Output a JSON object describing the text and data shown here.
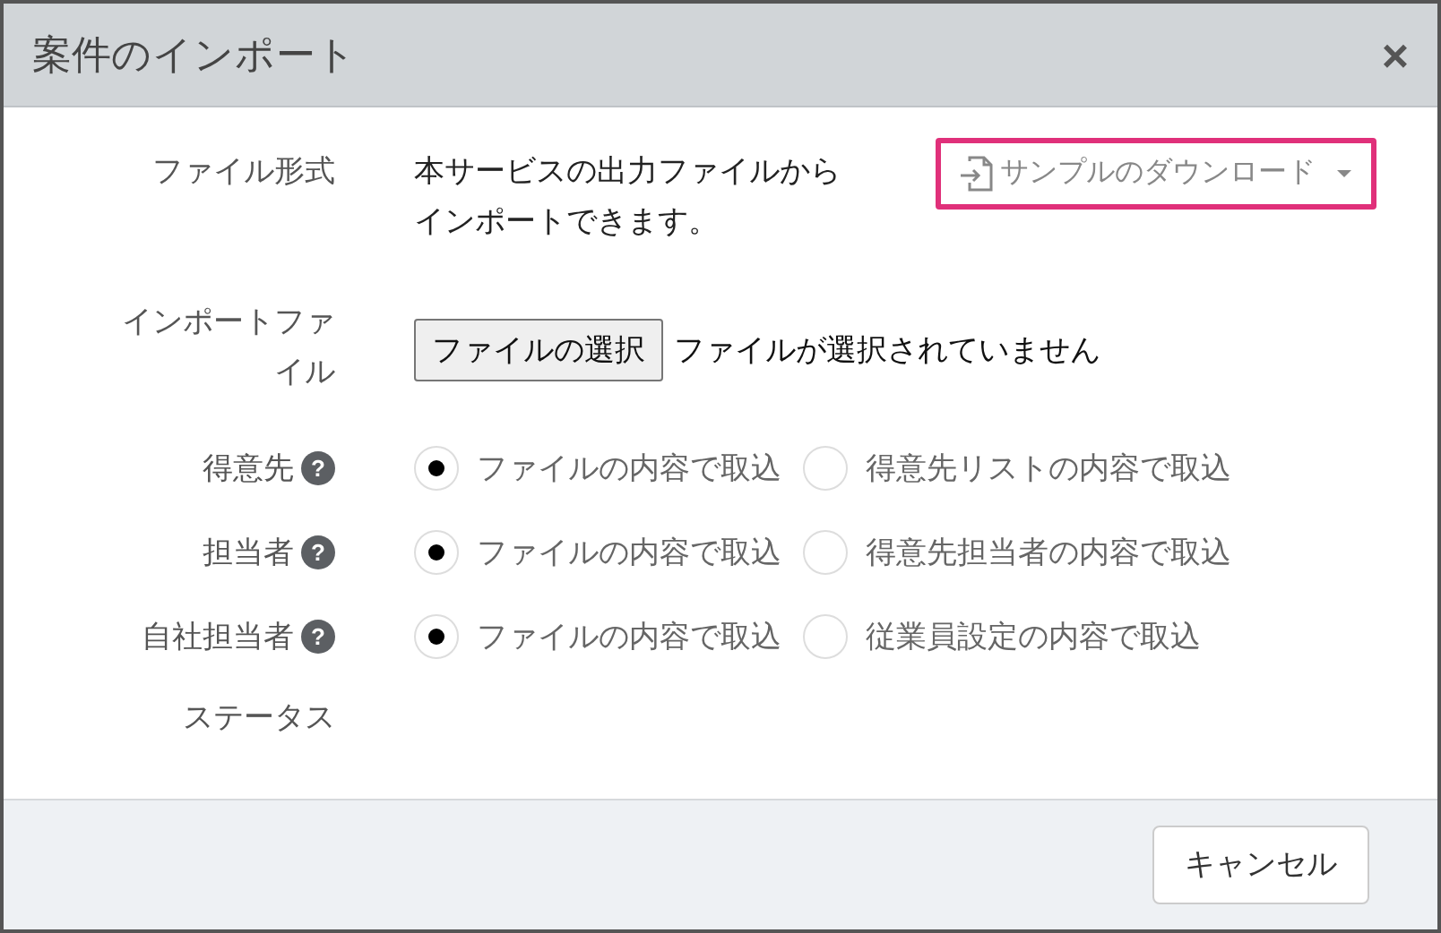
{
  "dialog": {
    "title": "案件のインポート",
    "close": "×"
  },
  "fields": [
    {
      "kind": "info",
      "label": "ファイル形式",
      "text": "本サービスの出力ファイルからインポートできます。",
      "menu_button": "サンプルのダウンロード"
    },
    {
      "kind": "file",
      "label": "インポートファイル",
      "button": "ファイルの選択",
      "status": "ファイルが選択されていません"
    },
    {
      "kind": "radio",
      "label": "得意先",
      "help": "?",
      "options": [
        {
          "label": "ファイルの内容で取込",
          "selected": true
        },
        {
          "label": "得意先リストの内容で取込",
          "selected": false
        }
      ]
    },
    {
      "kind": "radio",
      "label": "担当者",
      "help": "?",
      "options": [
        {
          "label": "ファイルの内容で取込",
          "selected": true
        },
        {
          "label": "得意先担当者の内容で取込",
          "selected": false
        }
      ]
    },
    {
      "kind": "radio",
      "label": "自社担当者",
      "help": "?",
      "options": [
        {
          "label": "ファイルの内容で取込",
          "selected": true
        },
        {
          "label": "従業員設定の内容で取込",
          "selected": false
        }
      ]
    },
    {
      "kind": "empty",
      "label": "ステータス"
    }
  ],
  "footer": {
    "cancel": "キャンセル"
  }
}
